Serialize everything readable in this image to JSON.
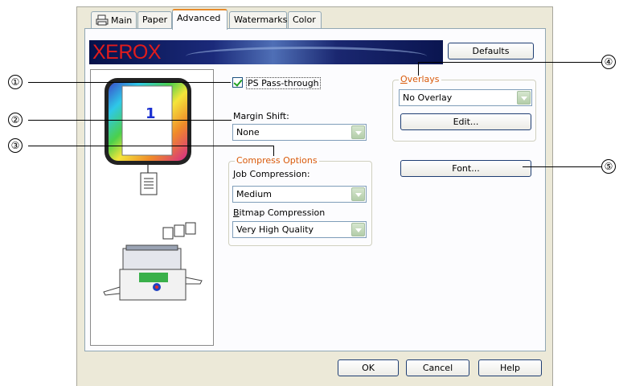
{
  "tabs": [
    {
      "label": "Main",
      "icon": "printer-icon"
    },
    {
      "label": "Paper"
    },
    {
      "label": "Advanced",
      "active": true
    },
    {
      "label": "Watermarks"
    },
    {
      "label": "Color"
    }
  ],
  "brand": "XEROX",
  "defaults_button": "Defaults",
  "preview": {
    "page_number": "1"
  },
  "ps_passthrough": {
    "label": "PS Pass-through",
    "checked": true
  },
  "margin_shift": {
    "label": "Margin Shift:",
    "value": "None"
  },
  "compress": {
    "title": "Compress Options",
    "job_label": "Job Compression:",
    "job_value": "Medium",
    "bitmap_label": "Bitmap Compression",
    "bitmap_value": "Very High Quality"
  },
  "overlays": {
    "title": "Overlays",
    "value": "No Overlay",
    "edit_button": "Edit..."
  },
  "font_button": "Font...",
  "footer": {
    "ok": "OK",
    "cancel": "Cancel",
    "help": "Help"
  },
  "callouts": [
    "①",
    "②",
    "③",
    "④",
    "⑤"
  ]
}
